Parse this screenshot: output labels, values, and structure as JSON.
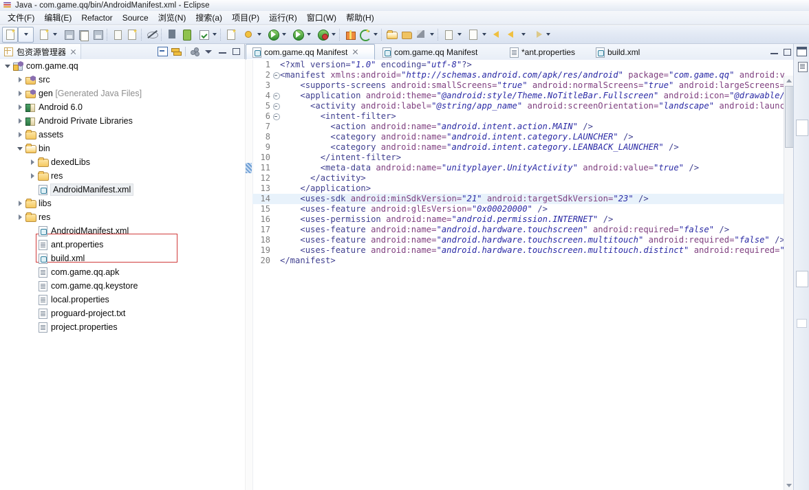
{
  "window": {
    "title": "Java - com.game.qq/bin/AndroidManifest.xml - Eclipse",
    "app_icon": "eclipse-icon"
  },
  "menubar": {
    "items": [
      {
        "label": "文件(F)",
        "name": "menu-file"
      },
      {
        "label": "编辑(E)",
        "name": "menu-edit"
      },
      {
        "label": "Refactor",
        "name": "menu-refactor"
      },
      {
        "label": "Source",
        "name": "menu-source"
      },
      {
        "label": "浏览(N)",
        "name": "menu-navigate"
      },
      {
        "label": "搜索(a)",
        "name": "menu-search"
      },
      {
        "label": "项目(P)",
        "name": "menu-project"
      },
      {
        "label": "运行(R)",
        "name": "menu-run"
      },
      {
        "label": "窗口(W)",
        "name": "menu-window"
      },
      {
        "label": "帮助(H)",
        "name": "menu-help"
      }
    ]
  },
  "toolbar": {
    "buttons": [
      "new-wizard-button",
      "new-wizard-dropdown",
      "new-java-project-button",
      "new-java-project-dropdown",
      "save-button",
      "save-all-button",
      "print-button",
      "new-xml-button",
      "java-browsing-button",
      "toggle-mark-occurrences-button",
      "export-button",
      "android-device-button",
      "run-validation-button",
      "run-validation-dropdown",
      "new-android-project-button",
      "debug-button",
      "debug-dropdown",
      "run-button",
      "run-dropdown",
      "run-last-tool-button",
      "run-last-tool-dropdown",
      "android-sdk-manager-button",
      "android-avd-manager-button",
      "android-dropdown",
      "open-type-button",
      "open-resource-button",
      "search-button",
      "search-dropdown",
      "next-annotation-button",
      "next-annotation-dropdown",
      "previous-edit-button",
      "back-button",
      "forward-button",
      "forward-dropdown",
      "next-button",
      "next-dropdown"
    ]
  },
  "left_panel": {
    "tab_label": "包资源管理器",
    "tab_icon": "package-explorer-icon",
    "close_icon": "close-icon",
    "tools": [
      "collapse-all-icon",
      "link-with-editor-icon",
      "view-menu-dots-icon",
      "view-menu-icon",
      "minimize-icon",
      "maximize-icon"
    ],
    "tree": [
      {
        "label": "com.game.qq",
        "indent": 0,
        "twisty": "open",
        "icon": "java-project-icon"
      },
      {
        "label": "src",
        "indent": 1,
        "twisty": "closed",
        "icon": "source-folder-icon"
      },
      {
        "label": "gen",
        "suffix": " [Generated Java Files]",
        "indent": 1,
        "twisty": "closed",
        "icon": "source-folder-icon"
      },
      {
        "label": "Android 6.0",
        "indent": 1,
        "twisty": "closed",
        "icon": "library-icon"
      },
      {
        "label": "Android Private Libraries",
        "indent": 1,
        "twisty": "closed",
        "icon": "library-icon"
      },
      {
        "label": "assets",
        "indent": 1,
        "twisty": "closed",
        "icon": "folder-icon"
      },
      {
        "label": "bin",
        "indent": 1,
        "twisty": "open",
        "icon": "folder-open-icon"
      },
      {
        "label": "dexedLibs",
        "indent": 2,
        "twisty": "closed",
        "icon": "folder-icon"
      },
      {
        "label": "res",
        "indent": 2,
        "twisty": "closed",
        "icon": "folder-icon"
      },
      {
        "label": "AndroidManifest.xml",
        "indent": 2,
        "twisty": "none",
        "icon": "xml-file-icon",
        "selected": true
      },
      {
        "label": "libs",
        "indent": 1,
        "twisty": "closed",
        "icon": "folder-icon"
      },
      {
        "label": "res",
        "indent": 1,
        "twisty": "closed",
        "icon": "folder-icon"
      },
      {
        "label": "AndroidManifest.xml",
        "indent": 2,
        "twisty": "none",
        "icon": "xml-file-icon"
      },
      {
        "label": "ant.properties",
        "indent": 2,
        "twisty": "none",
        "icon": "file-icon"
      },
      {
        "label": "build.xml",
        "indent": 2,
        "twisty": "none",
        "icon": "xml-file-icon"
      },
      {
        "label": "com.game.qq.apk",
        "indent": 2,
        "twisty": "none",
        "icon": "file-icon"
      },
      {
        "label": "com.game.qq.keystore",
        "indent": 2,
        "twisty": "none",
        "icon": "file-icon"
      },
      {
        "label": "local.properties",
        "indent": 2,
        "twisty": "none",
        "icon": "file-icon"
      },
      {
        "label": "proguard-project.txt",
        "indent": 2,
        "twisty": "none",
        "icon": "file-icon"
      },
      {
        "label": "project.properties",
        "indent": 2,
        "twisty": "none",
        "icon": "file-icon"
      }
    ],
    "highlight_box_color": "#d03a3a"
  },
  "editor": {
    "tabs": [
      {
        "label": "com.game.qq Manifest",
        "icon": "xml-file-icon",
        "active": true,
        "closable": true
      },
      {
        "label": "com.game.qq Manifest",
        "icon": "xml-file-icon",
        "active": false,
        "closable": false
      },
      {
        "label": "*ant.properties",
        "icon": "file-icon",
        "active": false,
        "closable": false
      },
      {
        "label": "build.xml",
        "icon": "xml-file-icon",
        "active": false,
        "closable": false
      }
    ],
    "controls": [
      "minimize-icon",
      "maximize-icon"
    ],
    "current_line": 14,
    "lines": [
      {
        "n": 1,
        "fold": false,
        "html": "<span class=\"pi\">&lt;?xml version=</span><span class=\"vl\">\"1.0\"</span><span class=\"pi\"> encoding=</span><span class=\"vl\">\"utf-8\"</span><span class=\"pi\">?&gt;</span>"
      },
      {
        "n": 2,
        "fold": true,
        "html": "<span class=\"tg\">&lt;manifest </span><span class=\"at\">xmlns:android=</span><span class=\"vl\">\"http://schemas.android.com/apk/res/android\"</span><span class=\"at\"> package=</span><span class=\"vl\">\"com.game.qq\"</span><span class=\"at\"> android:versi</span>"
      },
      {
        "n": 3,
        "fold": false,
        "html": "    <span class=\"tg\">&lt;supports-screens </span><span class=\"at\">android:smallScreens=</span><span class=\"vl\">\"true\"</span><span class=\"at\"> android:normalScreens=</span><span class=\"vl\">\"true\"</span><span class=\"at\"> android:largeScreens=</span><span class=\"vl\">\"true\"</span>"
      },
      {
        "n": 4,
        "fold": true,
        "html": "    <span class=\"tg\">&lt;application </span><span class=\"at\">android:theme=</span><span class=\"vl\">\"@android:style/Theme.NoTitleBar.Fullscreen\"</span><span class=\"at\"> android:icon=</span><span class=\"vl\">\"@drawable/app_ic</span>"
      },
      {
        "n": 5,
        "fold": true,
        "html": "      <span class=\"tg\">&lt;activity </span><span class=\"at\">android:label=</span><span class=\"vl\">\"@string/app_name\"</span><span class=\"at\"> android:screenOrientation=</span><span class=\"vl\">\"landscape\"</span><span class=\"at\"> android:launchMode=</span>"
      },
      {
        "n": 6,
        "fold": true,
        "html": "        <span class=\"tg\">&lt;intent-filter&gt;</span>"
      },
      {
        "n": 7,
        "fold": false,
        "html": "          <span class=\"tg\">&lt;action </span><span class=\"at\">android:name=</span><span class=\"vl\">\"android.intent.action.MAIN\"</span><span class=\"tg\"> /&gt;</span>"
      },
      {
        "n": 8,
        "fold": false,
        "html": "          <span class=\"tg\">&lt;category </span><span class=\"at\">android:name=</span><span class=\"vl\">\"android.intent.category.LAUNCHER\"</span><span class=\"tg\"> /&gt;</span>"
      },
      {
        "n": 9,
        "fold": false,
        "html": "          <span class=\"tg\">&lt;category </span><span class=\"at\">android:name=</span><span class=\"vl\">\"android.intent.category.LEANBACK_LAUNCHER\"</span><span class=\"tg\"> /&gt;</span>"
      },
      {
        "n": 10,
        "fold": false,
        "html": "        <span class=\"tg\">&lt;/intent-filter&gt;</span>"
      },
      {
        "n": 11,
        "fold": false,
        "html": "        <span class=\"tg\">&lt;meta-data </span><span class=\"at\">android:name=</span><span class=\"vl\">\"unityplayer.UnityActivity\"</span><span class=\"at\"> android:value=</span><span class=\"vl\">\"true\"</span><span class=\"tg\"> /&gt;</span>"
      },
      {
        "n": 12,
        "fold": false,
        "html": "      <span class=\"tg\">&lt;/activity&gt;</span>"
      },
      {
        "n": 13,
        "fold": false,
        "html": "    <span class=\"tg\">&lt;/application&gt;</span>"
      },
      {
        "n": 14,
        "fold": false,
        "hl": true,
        "html": "    <span class=\"tg\">&lt;uses-sdk </span><span class=\"at\">android:minSdkVersion=</span><span class=\"vl\">\"21\"</span><span class=\"at\"> android:targetSdkVersion=</span><span class=\"vl\">\"23\"</span><span class=\"tg\"> /&gt;</span>"
      },
      {
        "n": 15,
        "fold": false,
        "html": "    <span class=\"tg\">&lt;uses-feature </span><span class=\"at\">android:glEsVersion=</span><span class=\"vl\">\"0x00020000\"</span><span class=\"tg\"> /&gt;</span>"
      },
      {
        "n": 16,
        "fold": false,
        "html": "    <span class=\"tg\">&lt;uses-permission </span><span class=\"at\">android:name=</span><span class=\"vl\">\"android.permission.INTERNET\"</span><span class=\"tg\"> /&gt;</span>"
      },
      {
        "n": 17,
        "fold": false,
        "html": "    <span class=\"tg\">&lt;uses-feature </span><span class=\"at\">android:name=</span><span class=\"vl\">\"android.hardware.touchscreen\"</span><span class=\"at\"> android:required=</span><span class=\"vl\">\"false\"</span><span class=\"tg\"> /&gt;</span>"
      },
      {
        "n": 18,
        "fold": false,
        "html": "    <span class=\"tg\">&lt;uses-feature </span><span class=\"at\">android:name=</span><span class=\"vl\">\"android.hardware.touchscreen.multitouch\"</span><span class=\"at\"> android:required=</span><span class=\"vl\">\"false\"</span><span class=\"tg\"> /&gt;</span>"
      },
      {
        "n": 19,
        "fold": false,
        "html": "    <span class=\"tg\">&lt;uses-feature </span><span class=\"at\">android:name=</span><span class=\"vl\">\"android.hardware.touchscreen.multitouch.distinct\"</span><span class=\"at\"> android:required=</span><span class=\"vl\">\"false\"</span>"
      },
      {
        "n": 20,
        "fold": false,
        "html": "<span class=\"tg\">&lt;/manifest&gt;</span>"
      }
    ]
  },
  "right_strip": {
    "buttons": [
      "restore-view-icon",
      "outline-view-icon"
    ]
  }
}
